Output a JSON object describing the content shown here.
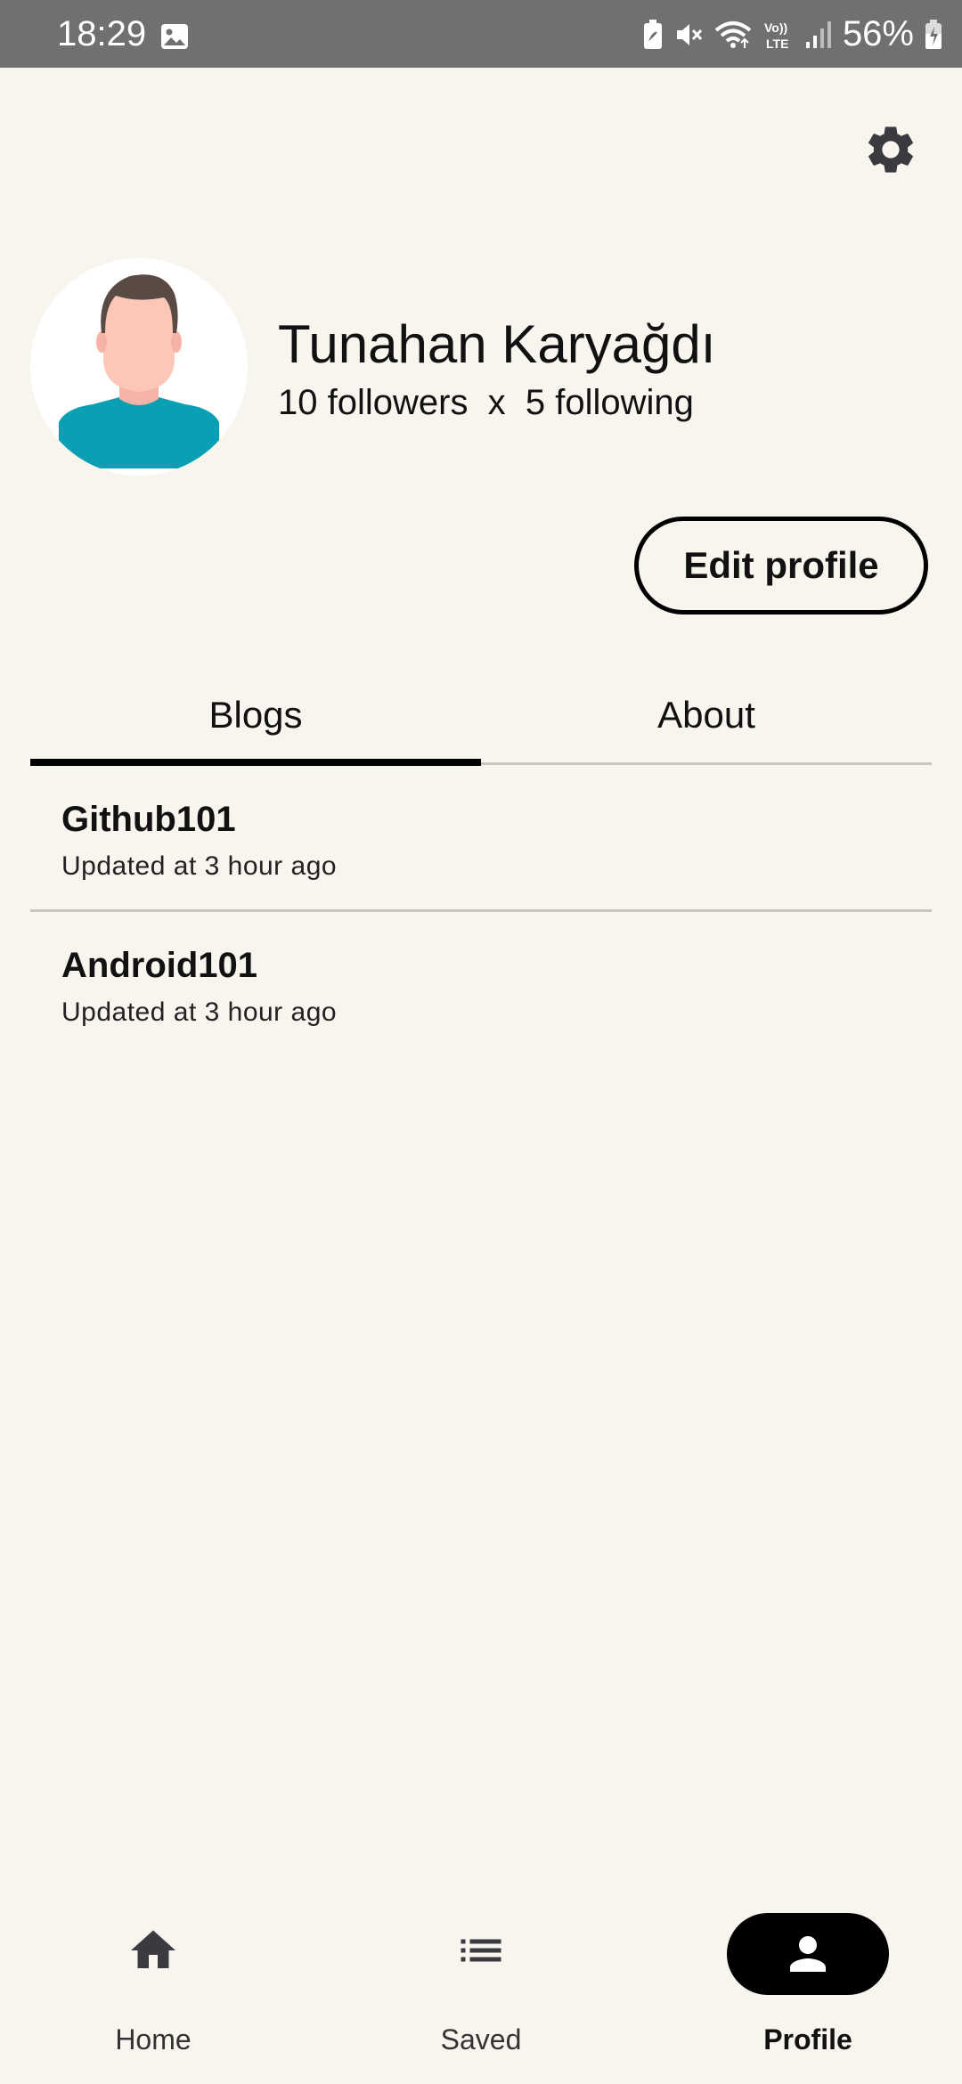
{
  "status_bar": {
    "time": "18:29",
    "battery": "56%",
    "icons": [
      "gallery-icon",
      "battery-saver-icon",
      "mute-icon",
      "wifi-icon",
      "volte-icon",
      "signal-icon",
      "battery-icon"
    ]
  },
  "profile": {
    "name": "Tunahan Karyağdı",
    "followers": "10 followers",
    "separator": "x",
    "following": "5 following",
    "edit_button": "Edit profile"
  },
  "tabs": [
    {
      "label": "Blogs",
      "selected": true
    },
    {
      "label": "About",
      "selected": false
    }
  ],
  "blogs": [
    {
      "title": "Github101",
      "updated": "Updated at 3 hour ago"
    },
    {
      "title": "Android101",
      "updated": "Updated at 3 hour ago"
    }
  ],
  "bottom_nav": [
    {
      "label": "Home",
      "icon": "home-icon"
    },
    {
      "label": "Saved",
      "icon": "list-icon"
    },
    {
      "label": "Profile",
      "icon": "person-icon",
      "selected": true
    }
  ],
  "colors": {
    "background": "#f8f4ee",
    "status_bar": "#707070",
    "accent": "#000000",
    "divider": "#c8c5c0",
    "avatar_shirt": "#0a9fb4",
    "avatar_skin": "#fcc6b8",
    "avatar_hair": "#5a4a44"
  }
}
